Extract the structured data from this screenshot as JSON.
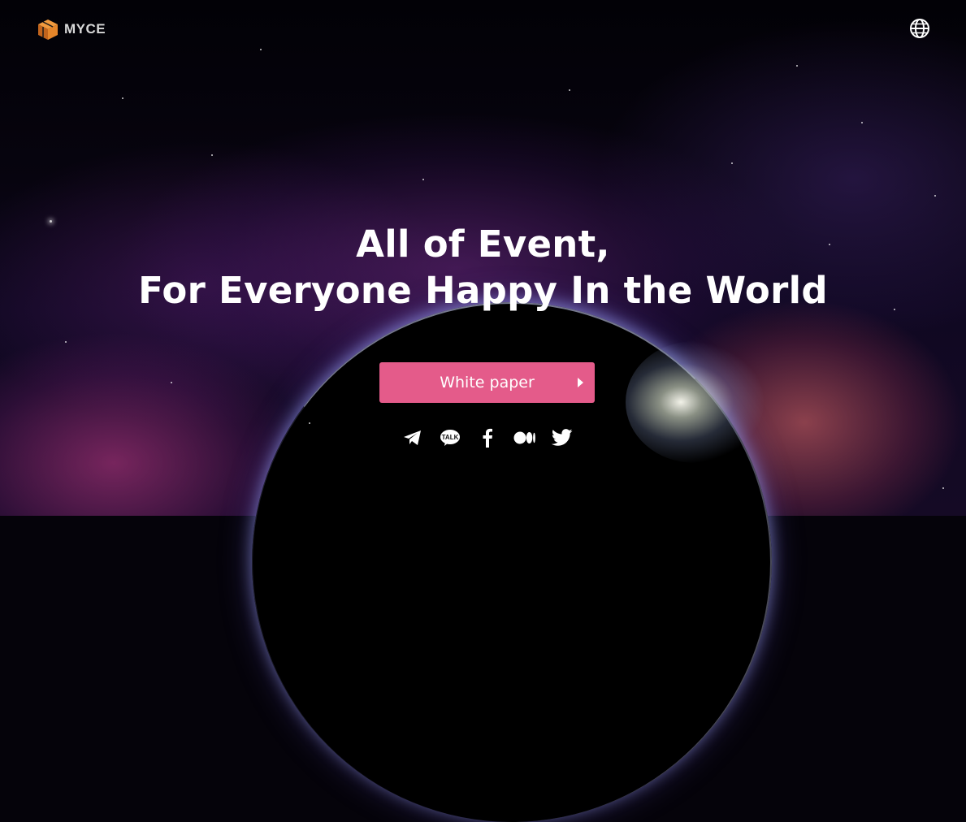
{
  "header": {
    "logo_text": "MYCE",
    "logo_color": "#e6862a",
    "language_icon": "globe-icon"
  },
  "hero": {
    "title_line1": "All of Event,",
    "title_line2": "For Everyone Happy In the World",
    "cta_label": "White paper",
    "cta_color": "#e45b8a"
  },
  "socials": [
    {
      "name": "telegram-icon"
    },
    {
      "name": "kakaotalk-icon",
      "label": "TALK"
    },
    {
      "name": "facebook-icon"
    },
    {
      "name": "medium-icon"
    },
    {
      "name": "twitter-icon"
    }
  ]
}
